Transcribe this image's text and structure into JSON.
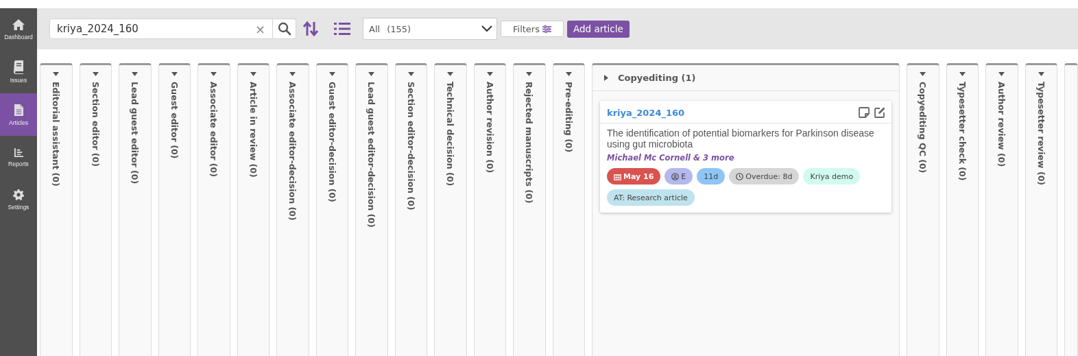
{
  "sidebar": {
    "items": [
      {
        "label": "Dashboard",
        "kind": "home",
        "selected": false
      },
      {
        "label": "Issues",
        "kind": "book",
        "selected": false
      },
      {
        "label": "Articles",
        "kind": "file",
        "selected": true
      },
      {
        "label": "Reports",
        "kind": "chart",
        "selected": false
      },
      {
        "label": "Settings",
        "kind": "gear",
        "selected": false
      }
    ]
  },
  "toolbar": {
    "search": {
      "value": "kriya_2024_160",
      "clear": "×"
    },
    "filter_select": {
      "value": "All",
      "count": "(155)"
    },
    "filters_button": "Filters",
    "add_button": "Add article"
  },
  "columns": [
    {
      "label": "Editorial assistant (0)",
      "expanded": false
    },
    {
      "label": "Section editor (0)",
      "expanded": false
    },
    {
      "label": "Lead guest editor (0)",
      "expanded": false
    },
    {
      "label": "Guest editor (0)",
      "expanded": false
    },
    {
      "label": "Associate editor (0)",
      "expanded": false
    },
    {
      "label": "Article in review (0)",
      "expanded": false
    },
    {
      "label": "Associate editor-decision (0)",
      "expanded": false
    },
    {
      "label": "Guest editor-decision (0)",
      "expanded": false
    },
    {
      "label": "Lead guest editor-decision (0)",
      "expanded": false
    },
    {
      "label": "Section editor-decision (0)",
      "expanded": false
    },
    {
      "label": "Technical decision (0)",
      "expanded": false
    },
    {
      "label": "Author revision (0)",
      "expanded": false
    },
    {
      "label": "Rejected manuscripts (0)",
      "expanded": false
    },
    {
      "label": "Pre-editing (0)",
      "expanded": false
    },
    {
      "label": "Copyediting (1)",
      "expanded": true,
      "cards": [
        {
          "id": "kriya_2024_160",
          "title": "The identification of potential biomarkers for Parkinson disease using gut microbiota",
          "authors": "Michael Mc Cornell & 3 more",
          "tags": [
            {
              "kind": "date",
              "text": "May 16",
              "color": "#d9534f"
            },
            {
              "kind": "user",
              "text": "E",
              "color": "#b3b9ec"
            },
            {
              "kind": "plain",
              "text": "11d",
              "color": "#8ec5f5"
            },
            {
              "kind": "clock",
              "text": "Overdue: 8d",
              "color": "#d6d6d6"
            },
            {
              "kind": "plain",
              "text": "Kriya demo",
              "color": "#d2fbef"
            },
            {
              "kind": "plain",
              "text": "AT: Research article",
              "color": "#bfe3ee"
            }
          ]
        }
      ]
    },
    {
      "label": "Copyediting QC (0)",
      "expanded": false
    },
    {
      "label": "Typesetter check (0)",
      "expanded": false
    },
    {
      "label": "Author review (0)",
      "expanded": false
    },
    {
      "label": "Typesetter review (0)",
      "expanded": false
    }
  ]
}
